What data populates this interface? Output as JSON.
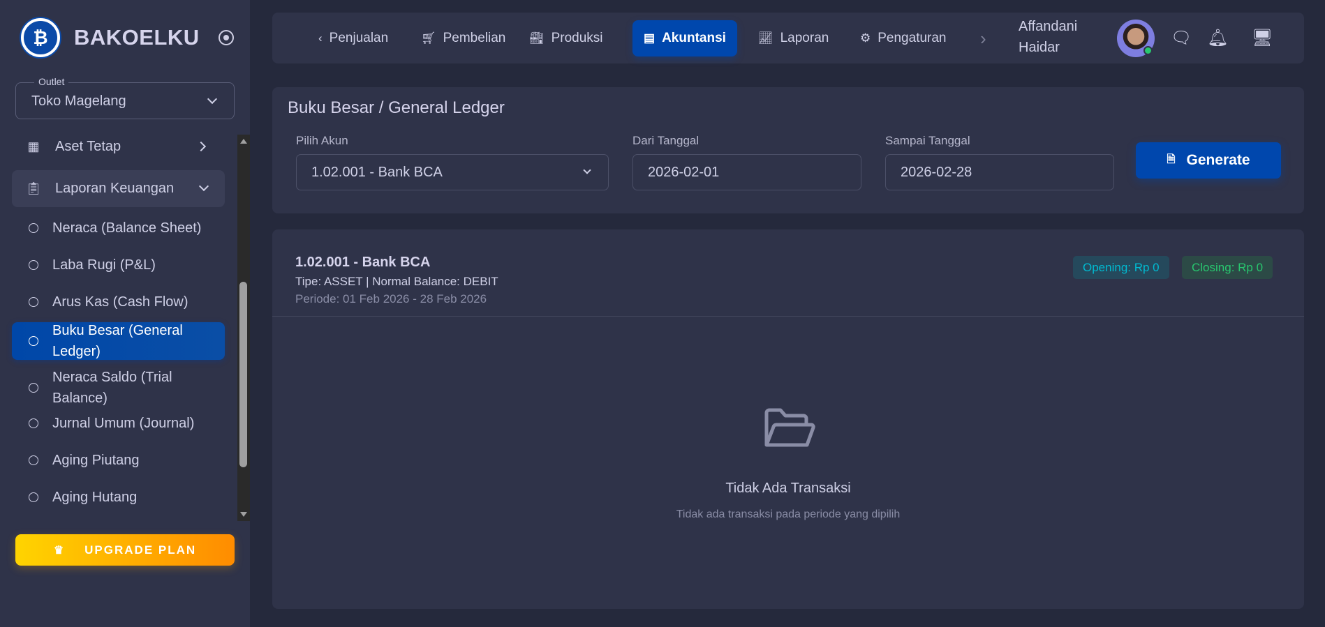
{
  "sidebar": {
    "brand": "BAKOELKU",
    "outlet": {
      "label": "Outlet",
      "value": "Toko Magelang"
    },
    "items": [
      {
        "label": "Aset Tetap",
        "icon": "building-icon"
      },
      {
        "label": "Laporan Keuangan",
        "icon": "clipboard-report-icon"
      }
    ],
    "sub_items": [
      "Neraca (Balance Sheet)",
      "Laba Rugi (P&L)",
      "Arus Kas (Cash Flow)",
      "Buku Besar (General Ledger)",
      "Neraca Saldo (Trial Balance)",
      "Jurnal Umum (Journal)",
      "Aging Piutang",
      "Aging Hutang"
    ],
    "active_sub": "Buku Besar (General Ledger)",
    "upgrade": "UPGRADE PLAN"
  },
  "topnav": {
    "items": [
      {
        "label": "Penjualan",
        "icon": "chevron-left-icon"
      },
      {
        "label": "Pembelian",
        "icon": "cart-icon"
      },
      {
        "label": "Produksi",
        "icon": "factory-icon"
      },
      {
        "label": "Akuntansi",
        "icon": "calculator-icon"
      },
      {
        "label": "Laporan",
        "icon": "chart-icon"
      },
      {
        "label": "Pengaturan",
        "icon": "gear-icon"
      }
    ],
    "active": "Akuntansi",
    "user_first": "Affandani",
    "user_last": "Haidar"
  },
  "filter": {
    "title": "Buku Besar / General Ledger",
    "account_label": "Pilih Akun",
    "account_value": "1.02.001 - Bank BCA",
    "from_label": "Dari Tanggal",
    "from_value": "2026-02-01",
    "to_label": "Sampai Tanggal",
    "to_value": "2026-02-28",
    "generate": "Generate"
  },
  "result": {
    "account": "1.02.001 - Bank BCA",
    "type_line": "Tipe: ASSET | Normal Balance: DEBIT",
    "period": "Periode: 01 Feb 2026 - 28 Feb 2026",
    "opening": "Opening: Rp 0",
    "closing": "Closing: Rp 0",
    "empty_title": "Tidak Ada Transaksi",
    "empty_sub": "Tidak ada transaksi pada periode yang dipilih"
  },
  "colors": {
    "accent": "#0047ad",
    "opening": "#00bad1",
    "closing": "#28c76f",
    "upgrade_start": "#ffd400",
    "upgrade_end": "#ff8c00"
  }
}
